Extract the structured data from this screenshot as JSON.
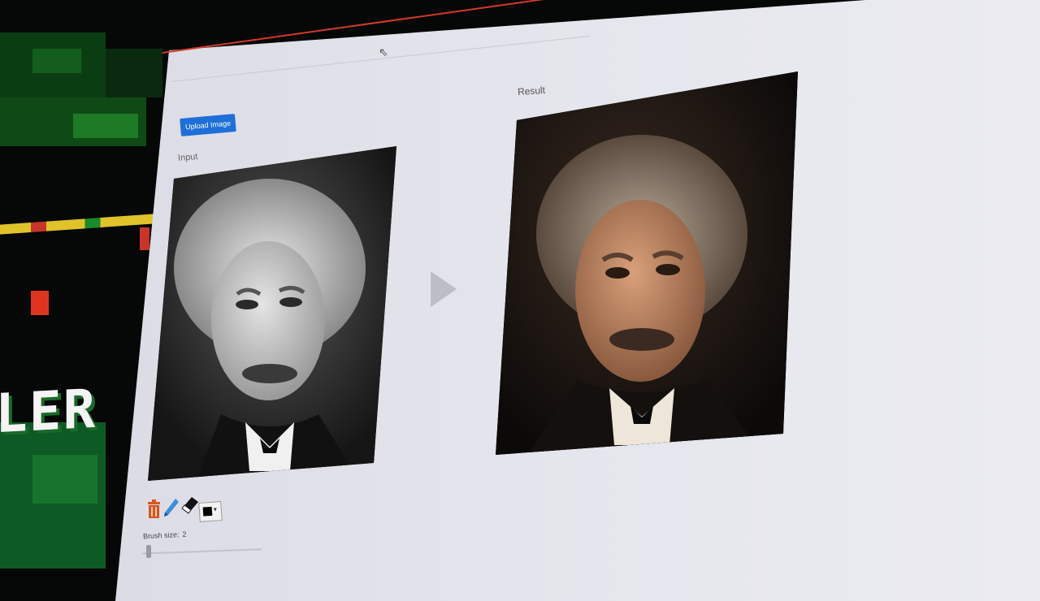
{
  "toolbar": {
    "upload_label": "Upload Image"
  },
  "panels": {
    "input_label": "Input",
    "result_label": "Result"
  },
  "tools": {
    "icons": [
      "trash-icon",
      "pencil-icon",
      "eraser-icon",
      "color-picker"
    ],
    "selected_color": "#000000",
    "brush_size_label": "Brush size:",
    "brush_size_value": "2"
  },
  "background": {
    "display_text": "LER"
  },
  "colors": {
    "accent": "#1e6fd8",
    "window_bg": "#e6e6ee"
  }
}
